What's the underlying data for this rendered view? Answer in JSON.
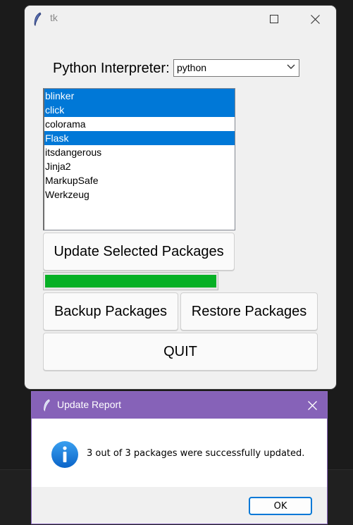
{
  "window": {
    "title": "tk"
  },
  "interpreter": {
    "label": "Python Interpreter:",
    "value": "python"
  },
  "packages": [
    {
      "name": "blinker",
      "selected": true
    },
    {
      "name": "click",
      "selected": true
    },
    {
      "name": "colorama",
      "selected": false
    },
    {
      "name": "Flask",
      "selected": true
    },
    {
      "name": "itsdangerous",
      "selected": false
    },
    {
      "name": "Jinja2",
      "selected": false
    },
    {
      "name": "MarkupSafe",
      "selected": false
    },
    {
      "name": "Werkzeug",
      "selected": false
    }
  ],
  "buttons": {
    "update": "Update Selected Packages",
    "backup": "Backup Packages",
    "restore": "Restore Packages",
    "quit": "QUIT"
  },
  "progress": {
    "value": 1.0,
    "color": "#06b025"
  },
  "dialog": {
    "title": "Update Report",
    "message": "3 out of 3 packages were successfully updated.",
    "ok": "OK",
    "icon": "info-icon",
    "accent": "#8662b8"
  },
  "colors": {
    "selection": "#0078d7"
  }
}
